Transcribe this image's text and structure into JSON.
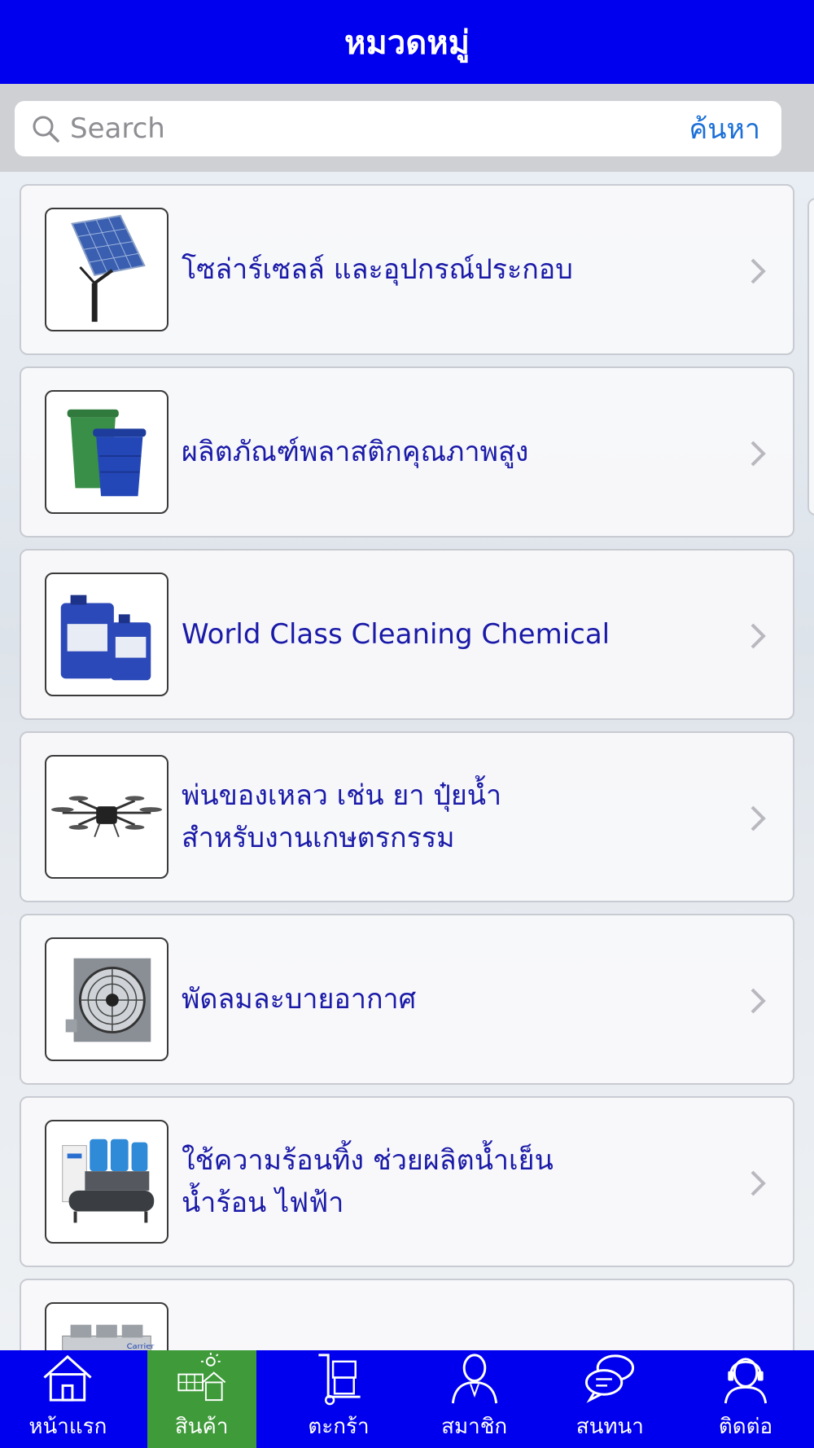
{
  "header": {
    "title": "หมวดหมู่"
  },
  "search": {
    "placeholder": "Search",
    "action_label": "ค้นหา"
  },
  "categories": [
    {
      "label": "โซล่าร์เซลล์ และอุปกรณ์ประกอบ",
      "icon": "solar-panel-icon"
    },
    {
      "label": "ผลิตภัณฑ์พลาสติกคุณภาพสูง",
      "icon": "plastic-bins-icon"
    },
    {
      "label": "World Class Cleaning Chemical",
      "icon": "chemical-containers-icon"
    },
    {
      "label": "พ่นของเหลว เช่น ยา ปุ๋ยน้ำ\nสำหรับงานเกษตรกรรม",
      "icon": "drone-icon"
    },
    {
      "label": "พัดลมละบายอากาศ",
      "icon": "exhaust-fan-icon"
    },
    {
      "label": "ใช้ความร้อนทิ้ง ช่วยผลิตน้ำเย็น\nน้ำร้อน ไฟฟ้า",
      "icon": "chiller-icon"
    },
    {
      "label": "",
      "icon": "cooling-unit-icon"
    }
  ],
  "tabbar": {
    "active": "products",
    "items": [
      {
        "id": "home",
        "label": "หน้าแรก",
        "icon": "home-icon"
      },
      {
        "id": "products",
        "label": "สินค้า",
        "icon": "products-icon"
      },
      {
        "id": "cart",
        "label": "ตะกร้า",
        "icon": "cart-icon"
      },
      {
        "id": "member",
        "label": "สมาชิก",
        "icon": "member-icon"
      },
      {
        "id": "chat",
        "label": "สนทนา",
        "icon": "chat-icon"
      },
      {
        "id": "contact",
        "label": "ติดต่อ",
        "icon": "contact-icon"
      }
    ]
  },
  "colors": {
    "brand": "#0000ee",
    "active_tab": "#3f9a3a",
    "label": "#1a1aa8",
    "search_action": "#1a6fd8"
  }
}
